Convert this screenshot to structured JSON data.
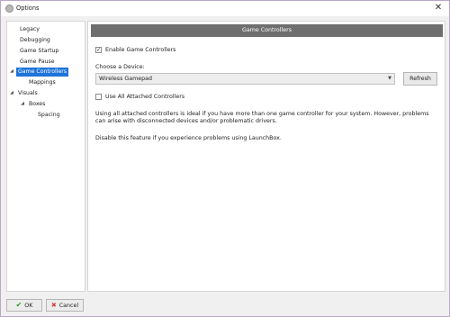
{
  "window": {
    "title": "Options",
    "close_glyph": "✕"
  },
  "tree": {
    "items": [
      {
        "label": "Legacy"
      },
      {
        "label": "Debugging"
      },
      {
        "label": "Game Startup"
      },
      {
        "label": "Game Pause"
      },
      {
        "label": "Game Controllers",
        "selected": true
      },
      {
        "label": "Mappings"
      },
      {
        "label": "Visuals"
      },
      {
        "label": "Boxes"
      },
      {
        "label": "Spacing"
      }
    ],
    "arrows": {
      "expanded": "◢",
      "open": "◢"
    }
  },
  "panel": {
    "header": "Game Controllers",
    "enable_label": "Enable Game Controllers",
    "enable_checked": true,
    "check_glyph": "✓",
    "choose_device_label": "Choose a Device:",
    "device_value": "Wireless Gamepad",
    "dropdown_glyph": "▼",
    "refresh_label": "Refresh",
    "use_all_label": "Use All Attached Controllers",
    "use_all_checked": false,
    "description_1": "Using all attached controllers is ideal if you have more than one game controller for your system. However, problems can arise with disconnected devices and/or problematic drivers.",
    "description_2": "Disable this feature if you experience problems using LaunchBox."
  },
  "footer": {
    "ok_label": "OK",
    "ok_glyph": "✔",
    "cancel_label": "Cancel",
    "cancel_glyph": "✖"
  },
  "colors": {
    "selection": "#1e73d8",
    "header": "#6e6e6e"
  }
}
